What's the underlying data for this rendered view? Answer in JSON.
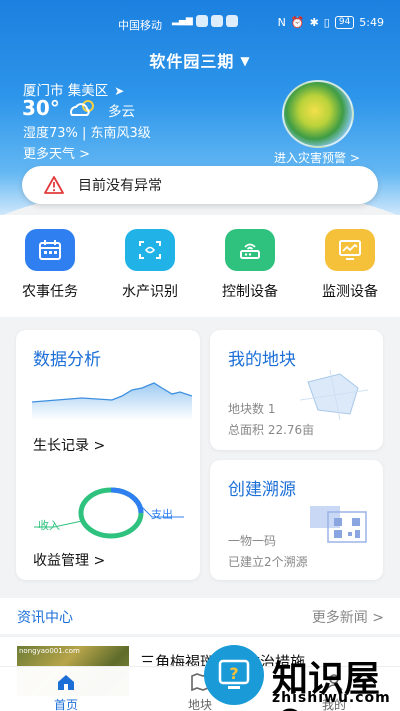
{
  "status_bar": {
    "carrier": "中国移动",
    "battery": "94",
    "time": "5:49"
  },
  "header": {
    "location": "软件园三期"
  },
  "weather": {
    "city": "厦门市 集美区",
    "temperature": "30°",
    "condition": "多云",
    "details": "湿度73% | 东南风3级",
    "more_link": "更多天气 >",
    "disaster_link": "进入灾害预警 >"
  },
  "alert": {
    "text": "目前没有异常"
  },
  "quick_actions": [
    {
      "label": "农事任务",
      "icon": "calendar-icon",
      "color": "#2f7ff0"
    },
    {
      "label": "水产识别",
      "icon": "scan-icon",
      "color": "#21b3e8"
    },
    {
      "label": "控制设备",
      "icon": "router-icon",
      "color": "#2ec27e"
    },
    {
      "label": "监测设备",
      "icon": "monitor-chart-icon",
      "color": "#f5c03a"
    }
  ],
  "cards": {
    "analysis": {
      "title": "数据分析",
      "growth_link": "生长记录 >",
      "income_link": "收益管理 >",
      "income_label": "收入",
      "expense_label": "支出"
    },
    "plots": {
      "title": "我的地块",
      "count": "地块数 1",
      "area": "总面积 22.76亩"
    },
    "trace": {
      "title": "创建溯源",
      "line1": "一物一码",
      "line2": "已建立2个溯源"
    }
  },
  "news": {
    "title": "资讯中心",
    "more": "更多新闻 >",
    "item_headline": "三角梅褐斑病的防治措施",
    "thumb_text": "nongyao001.com"
  },
  "tabs": [
    {
      "label": "首页",
      "icon": "home-icon"
    },
    {
      "label": "地块",
      "icon": "map-icon"
    },
    {
      "label": "我的",
      "icon": "user-icon"
    }
  ],
  "watermark": {
    "text": "知识屋®",
    "url": "zhishiwu.com"
  },
  "colors": {
    "accent": "#1d6fd8",
    "hero_top": "#1c80df"
  }
}
